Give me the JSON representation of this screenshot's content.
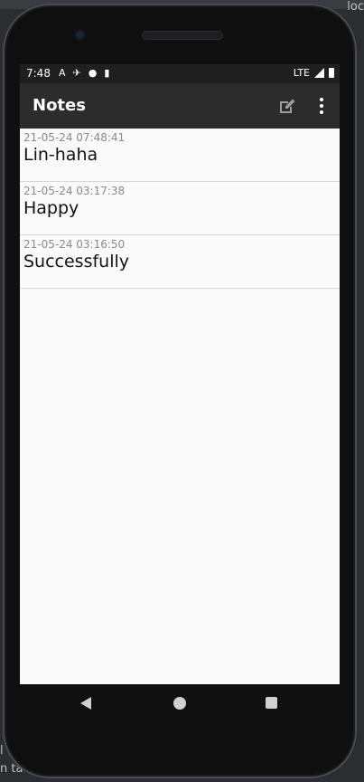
{
  "background": {
    "top_right_text": "loc",
    "left_text_1": "l",
    "left_text_2": "n ta"
  },
  "status_bar": {
    "time": "7:48",
    "network": "LTE",
    "notification_icons": [
      "A",
      "✈",
      "●",
      "▮"
    ]
  },
  "app_bar": {
    "title": "Notes",
    "new_note_icon": "edit-note-icon",
    "more_icon": "more-vert-icon"
  },
  "notes": [
    {
      "date": "21-05-24 07:48:41",
      "title": "Lin-haha"
    },
    {
      "date": "21-05-24 03:17:38",
      "title": "Happy"
    },
    {
      "date": "21-05-24 03:16:50",
      "title": "Successfully"
    }
  ],
  "colors": {
    "app_bar": "#2c2c2c",
    "status_bar": "#1f1f1f",
    "list_background": "#fafafa",
    "divider": "#d6d6d6"
  }
}
